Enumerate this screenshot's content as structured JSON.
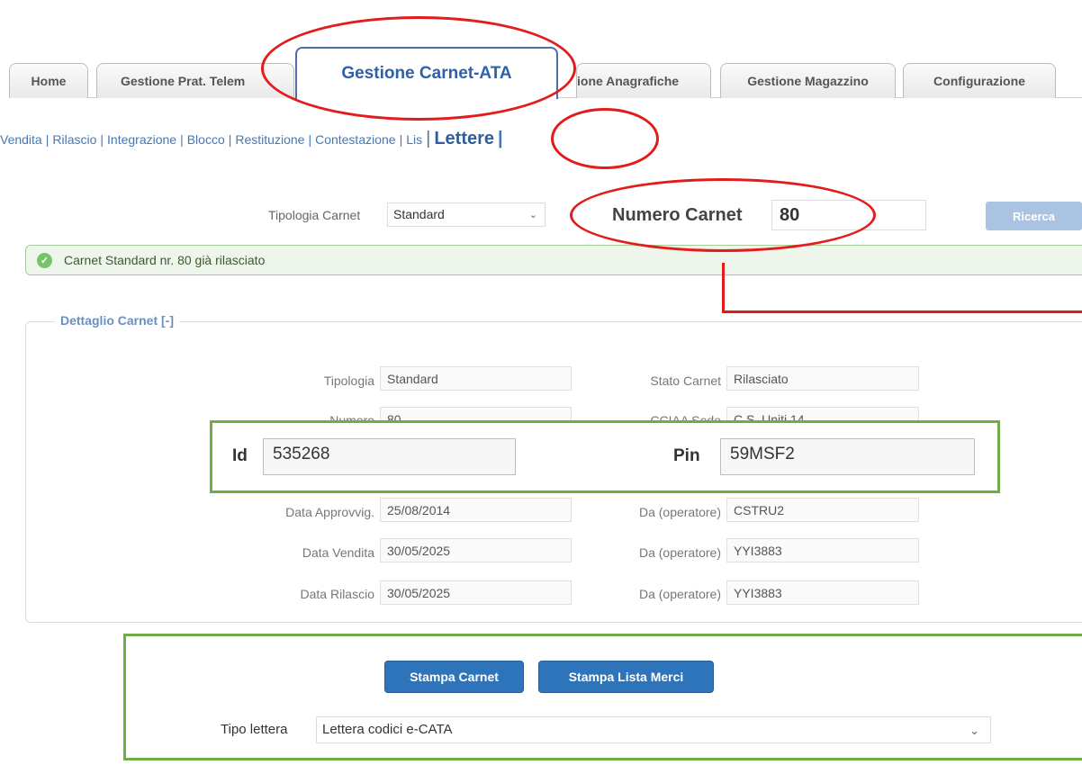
{
  "tabs": [
    {
      "label": "Home"
    },
    {
      "label": "Gestione Prat. Telem"
    },
    {
      "label": "Gestione Carnet-ATA"
    },
    {
      "label": "ione Anagrafiche"
    },
    {
      "label": "Gestione Magazzino"
    },
    {
      "label": "Configurazione"
    }
  ],
  "submenu": {
    "items": [
      "Vendita",
      "Rilascio",
      "Integrazione",
      "Blocco",
      "Restituzione",
      "Contestazione",
      "Lis"
    ],
    "current": "Lettere"
  },
  "search": {
    "tipologia_label": "Tipologia Carnet",
    "tipologia_value": "Standard",
    "numero_label": "Numero Carnet",
    "numero_value": "80",
    "ricerca_label": "Ricerca"
  },
  "alert": {
    "message": "Carnet Standard nr. 80 già rilasciato"
  },
  "detail": {
    "legend": "Dettaglio Carnet [-]",
    "tipologia_label": "Tipologia",
    "tipologia_value": "Standard",
    "stato_label": "Stato Carnet",
    "stato_value": "Rilasciato",
    "numero_label_partial": "Numero",
    "numero_value_partial": "80",
    "cciaa_label_partial": "CCIAA Sede",
    "cciaa_value_partial": "C.S. Uniti 14",
    "approv_label": "Data Approvvig.",
    "approv_value": "25/08/2014",
    "op1_label": "Da (operatore)",
    "op1_value": "CSTRU2",
    "vendita_label": "Data Vendita",
    "vendita_value": "30/05/2025",
    "op2_label": "Da (operatore)",
    "op2_value": "YYI3883",
    "rilascio_label": "Data Rilascio",
    "rilascio_value": "30/05/2025",
    "op3_label": "Da (operatore)",
    "op3_value": "YYI3883"
  },
  "overlay": {
    "id_label": "Id",
    "id_value": "535268",
    "pin_label": "Pin",
    "pin_value": "59MSF2"
  },
  "actions": {
    "stampa_carnet": "Stampa Carnet",
    "stampa_lista": "Stampa Lista Merci",
    "tipo_lettera_label": "Tipo lettera",
    "tipo_lettera_value": "Lettera codici e-CATA"
  },
  "icons": {
    "ok": "check-circle-icon",
    "chevron": "chevron-down-icon"
  },
  "colors": {
    "accent": "#2d74bb",
    "link": "#4478b5",
    "success_bg": "#eef6ec",
    "highlight_red": "#e31b1b",
    "highlight_green": "#70ad47"
  }
}
